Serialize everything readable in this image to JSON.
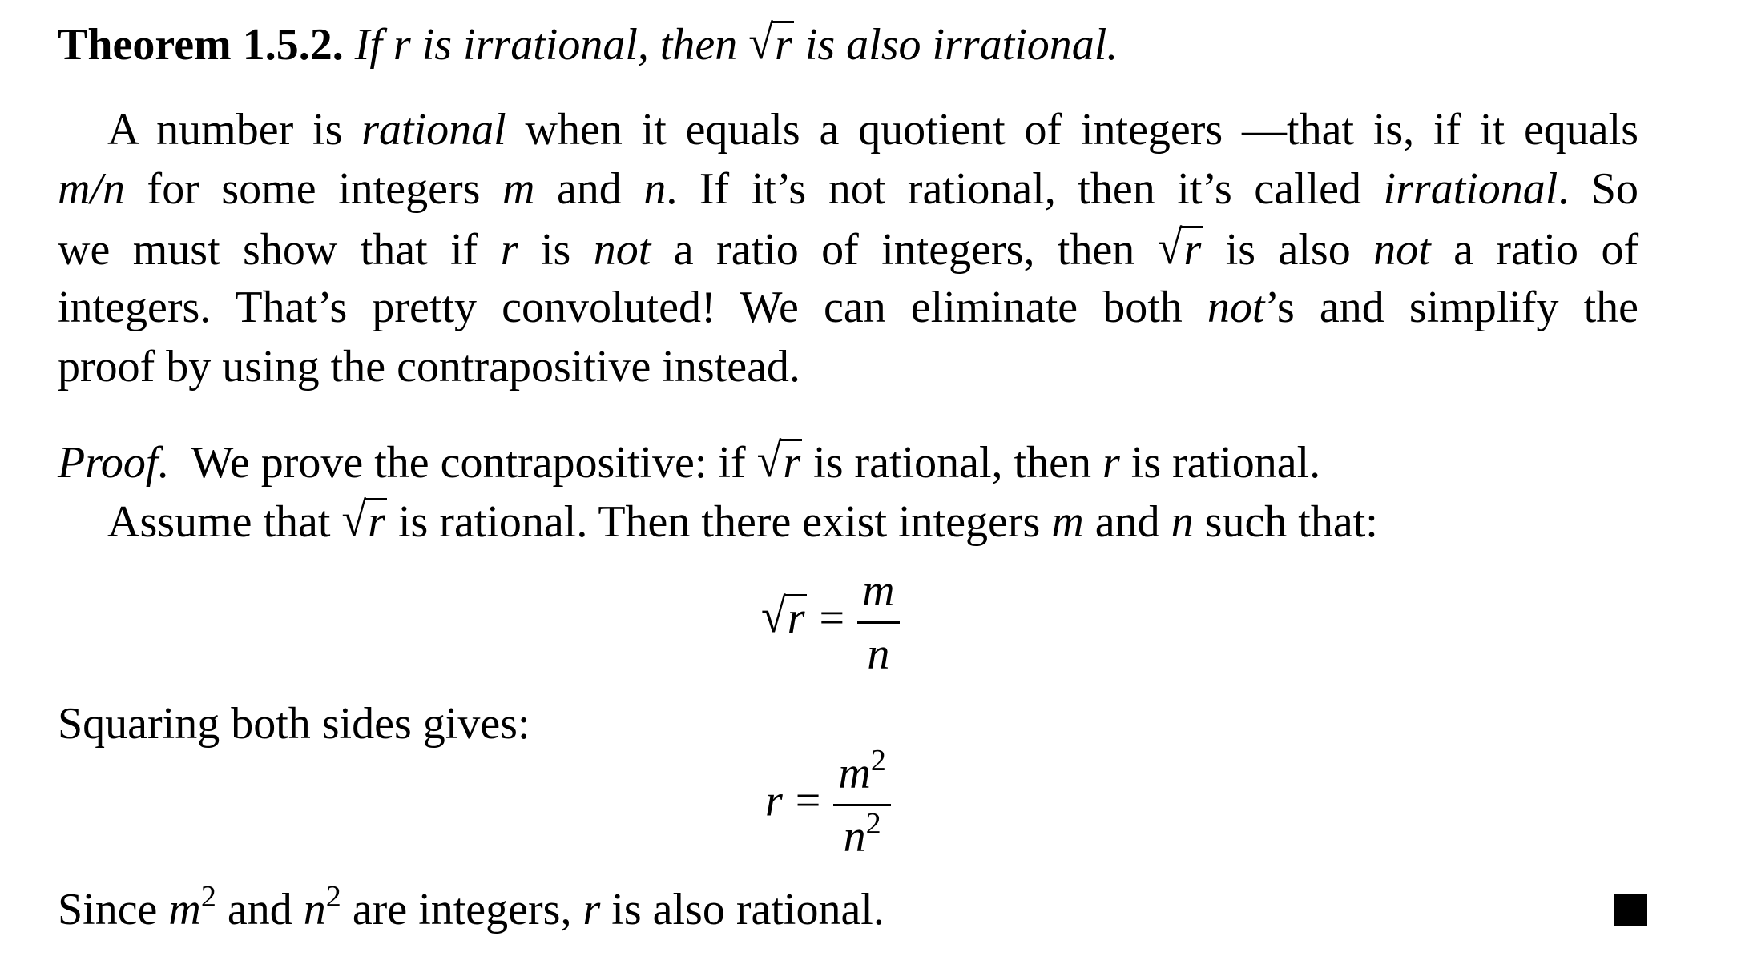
{
  "theorem": {
    "label": "Theorem 1.5.2.",
    "stmt_a": "If r is irrational, then",
    "radicand": "r",
    "stmt_b": "is also irrational."
  },
  "para": {
    "l1_a": "A number is",
    "l1_rational": "rational",
    "l1_b": "when it equals a quotient of integers —that is, if it equals",
    "l2_mn": "m/n",
    "l2_a": "for some integers",
    "l2_m": "m",
    "l2_and": "and",
    "l2_n": "n",
    "l2_b": ". If it’s not rational, then it’s called",
    "l2_irr": "irrational",
    "l2_c": ". So",
    "l3_a": "we must show that if",
    "l3_r": "r",
    "l3_is": "is",
    "l3_not": "not",
    "l3_b": "a ratio of integers, then",
    "l3_rad": "r",
    "l3_c": "is also",
    "l3_not2": "not",
    "l3_d": "a ratio of",
    "l4_a": "integers. That’s pretty convoluted! We can eliminate both",
    "l4_not": "not",
    "l4_b": "’s and simplify the",
    "l5": "proof by using the contrapositive instead."
  },
  "proof": {
    "label": "Proof.",
    "p1_a": "We prove the contrapositive: if",
    "p1_rad": "r",
    "p1_b": "is rational, then",
    "p1_r": "r",
    "p1_c": "is rational.",
    "p2_a": "Assume that",
    "p2_rad": "r",
    "p2_b": "is rational. Then there exist integers",
    "p2_m": "m",
    "p2_and": "and",
    "p2_n": "n",
    "p2_c": "such that:",
    "eq1": {
      "radicand": "r",
      "eq": "=",
      "num": "m",
      "den": "n"
    },
    "squaring": "Squaring both sides gives:",
    "eq2": {
      "lhs": "r",
      "eq": "=",
      "num": "m",
      "num_exp": "2",
      "den": "n",
      "den_exp": "2"
    },
    "since_a": "Since",
    "since_m": "m",
    "since_m_exp": "2",
    "since_and": "and",
    "since_n": "n",
    "since_n_exp": "2",
    "since_b": "are integers,",
    "since_r": "r",
    "since_c": "is also rational.",
    "qed_symbol": "■"
  }
}
